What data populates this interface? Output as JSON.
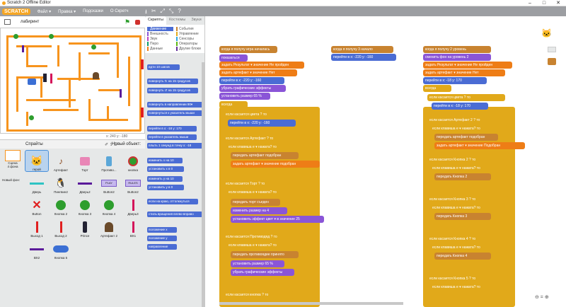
{
  "window": {
    "title": "Scratch 2 Offline Editor"
  },
  "menu": {
    "logo": "SCRATCH",
    "items": [
      "Файл ▾",
      "Правка ▾",
      "Подсказки",
      "О Скретч"
    ]
  },
  "stage": {
    "project_name": "лабиринт",
    "coords": "x: 240  y: -180"
  },
  "sprites": {
    "header": "Спрайты",
    "new_object": "Новый объект:",
    "stage_label": "Сцена\n4 фона",
    "new_bg": "Новый фон:",
    "list": [
      "герой",
      "Артефакт",
      "Торт",
      "Противо...",
      "кнопка",
      "Дверь",
      "Пингвин2",
      "Дверь2",
      "Button2",
      "Button2",
      "Button",
      "Кнопка 2",
      "Кнопка 3",
      "Кнопка 4",
      "Дверь3",
      "Выход 1",
      "Выход 2",
      "Prince",
      "Артефакт 2",
      "ВХ1",
      "ВХ2",
      "Кнопка 5"
    ]
  },
  "palette": {
    "tabs": [
      "Скрипты",
      "Костюмы",
      "Звуки"
    ],
    "categories": [
      {
        "name": "Движение",
        "color": "#4a6cd4"
      },
      {
        "name": "События",
        "color": "#c88330"
      },
      {
        "name": "Внешность",
        "color": "#8a55d7"
      },
      {
        "name": "Управление",
        "color": "#e1a91a"
      },
      {
        "name": "Звук",
        "color": "#bb42c3"
      },
      {
        "name": "Сенсоры",
        "color": "#2ca5e2"
      },
      {
        "name": "Перо",
        "color": "#0e9a6c"
      },
      {
        "name": "Операторы",
        "color": "#5cb712"
      },
      {
        "name": "Данные",
        "color": "#ee7d16"
      },
      {
        "name": "Другие блоки",
        "color": "#632d99"
      }
    ],
    "blocks": [
      "идти 10 шагов",
      "повернуть ↻ на 15 градусов",
      "повернуть ↺ на 15 градусов",
      "повернуть в направлении 90▾",
      "повернуться к указатель мыши",
      "перейти в x: -18 y: 170",
      "перейти в указатель мыши",
      "плыть 1 секунд в точку x: -18",
      "изменить x на 10",
      "установить x в 0",
      "изменить y на 10",
      "установить y в 0",
      "если на краю, оттолкнуться",
      "стиль вращения влево-вправо",
      "положение x",
      "положение y",
      "направление"
    ]
  },
  "scripts": {
    "col1": [
      "когда я получу игра началась",
      "показаться",
      "задать Результат ▾ значение Не пройден",
      "задать артефакт ▾ значение Нет",
      "перейти в x: -220 y: -160",
      "убрать графические эффекты",
      "установить размер 65 %",
      "всегда",
      "если касается цвета ? то",
      "перейти в x: -220 y: -160",
      "если касается Артефакт ? то",
      "если клавиша e ▾ нажата? то",
      "передать артефакт подобран",
      "задать артефакт ▾ значение подобран",
      "если касается Торт ? то",
      "если клавиша e ▾ нажата? то",
      "передать торт съеден",
      "изменить размер на 4",
      "установить эффект цвет ▾ в значение 25",
      "если касается Противодяд ? то",
      "если клавиша e ▾ нажата? то",
      "передать противоядие принято",
      "установить размер 65 %",
      "убрать графические эффекты",
      "если касается кнопка ? то"
    ],
    "col2": [
      "когда я получу 3 начало",
      "перейти в x: -220 y: -160"
    ],
    "col3": [
      "когда я получу 2 уровень",
      "сменить фон на уровень 2",
      "задать Результат ▾ значение Не пройден",
      "задать артефакт ▾ значение Нет",
      "перейти в x: -18 y: 170",
      "всегда",
      "если касается цвета ? то",
      "перейти в x: -18 y: 170",
      "если касается Артефакт 2 ? то",
      "если клавиша e ▾ нажата? то",
      "передать артефакт подобран",
      "задать артефакт ▾ значение Подобран",
      "если касается Кнопка 2 ? то",
      "если клавиша e ▾ нажата? то",
      "передать Кнопка 2",
      "если касается Кнопка 3 ? то",
      "если клавиша e ▾ нажата? то",
      "передать Кнопка 3",
      "если касается Кнопка 4 ? то",
      "если клавиша e ▾ нажата? то",
      "передать Кнопка 4",
      "если касается Кнопка 5 ? то",
      "если клавиша e ▾ нажата? то"
    ]
  },
  "zoom": "⊖ = ⊕"
}
